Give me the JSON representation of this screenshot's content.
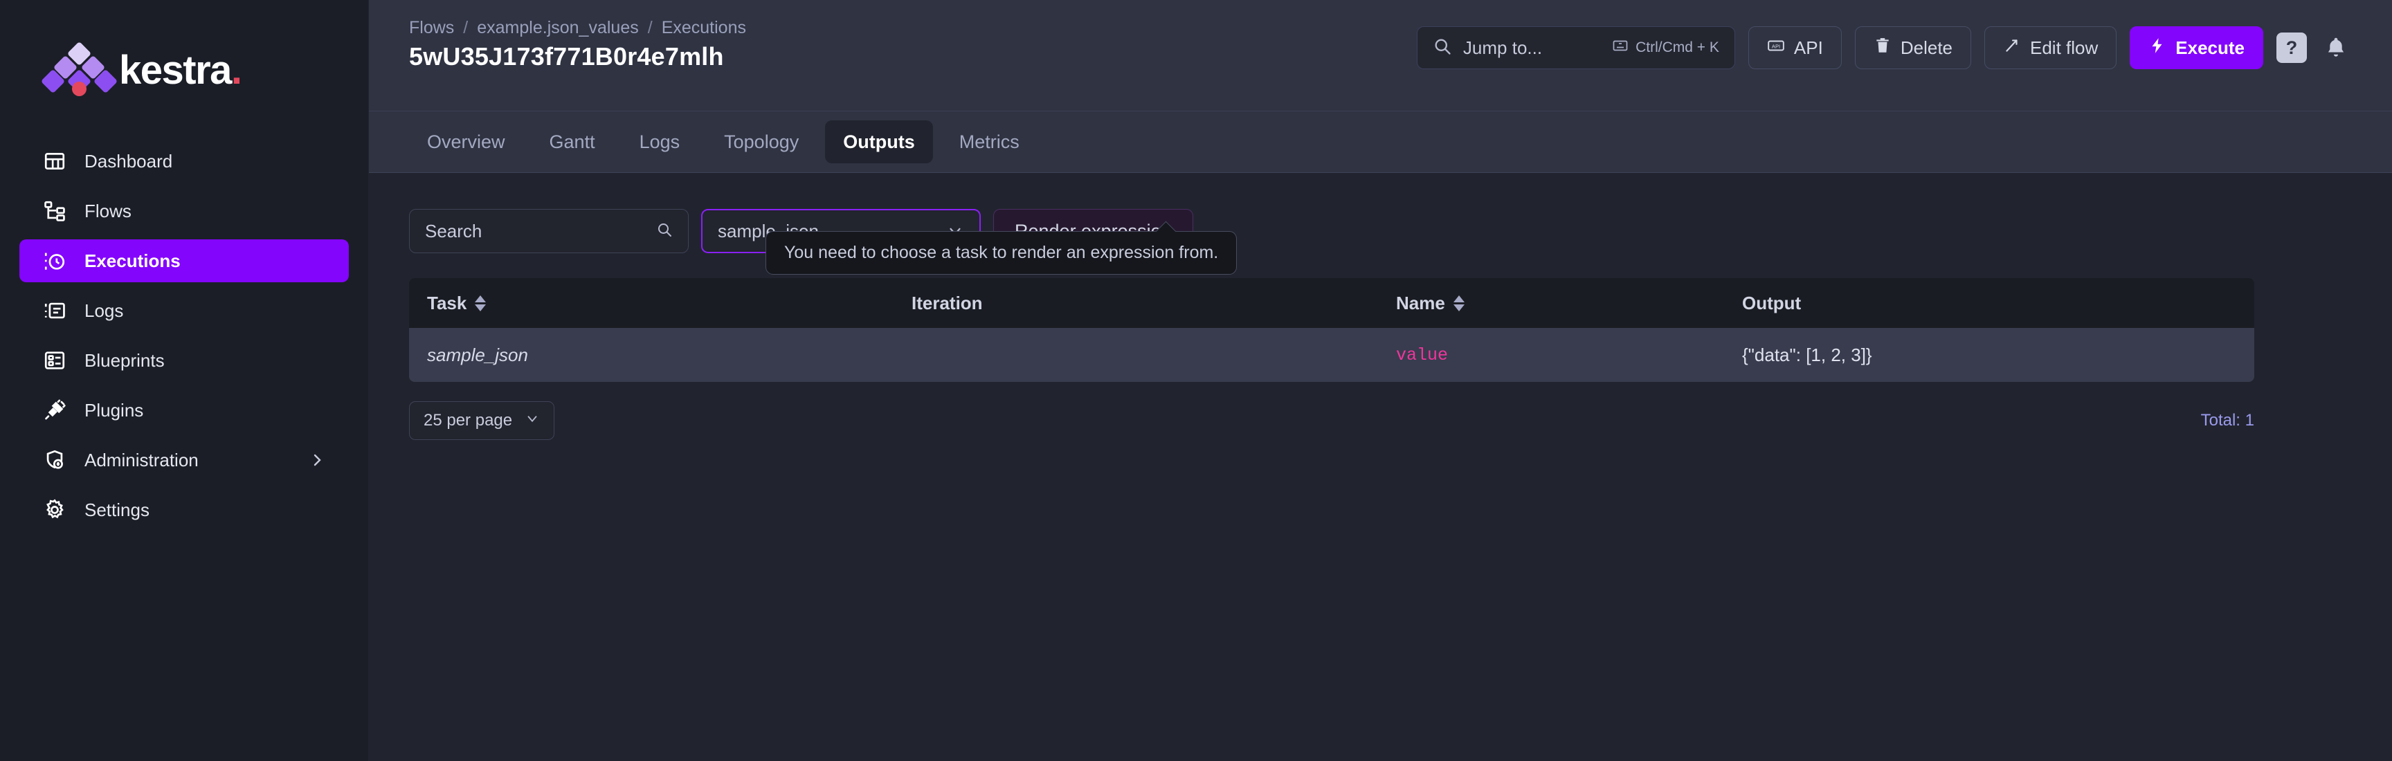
{
  "brand": {
    "name": "kestra",
    "accent": "#8405fc",
    "dot_color": "#e4485d"
  },
  "sidebar": {
    "items": [
      {
        "label": "Dashboard",
        "icon": "dashboard-icon",
        "active": false,
        "expandable": false
      },
      {
        "label": "Flows",
        "icon": "flows-icon",
        "active": false,
        "expandable": false
      },
      {
        "label": "Executions",
        "icon": "executions-icon",
        "active": true,
        "expandable": false
      },
      {
        "label": "Logs",
        "icon": "logs-icon",
        "active": false,
        "expandable": false
      },
      {
        "label": "Blueprints",
        "icon": "blueprints-icon",
        "active": false,
        "expandable": false
      },
      {
        "label": "Plugins",
        "icon": "plugins-icon",
        "active": false,
        "expandable": false
      },
      {
        "label": "Administration",
        "icon": "administration-icon",
        "active": false,
        "expandable": true
      },
      {
        "label": "Settings",
        "icon": "settings-icon",
        "active": false,
        "expandable": false
      }
    ]
  },
  "header": {
    "breadcrumb": [
      {
        "label": "Flows"
      },
      {
        "label": "example.json_values"
      },
      {
        "label": "Executions"
      }
    ],
    "breadcrumb_separator": "/",
    "title": "5wU35J173f771B0r4e7mlh",
    "jump_to": {
      "placeholder": "Jump to...",
      "shortcut": "Ctrl/Cmd + K",
      "icon": "search-icon",
      "keyboard_icon": "keyboard-icon"
    },
    "buttons": [
      {
        "label": "API",
        "icon": "api-icon",
        "style": "default"
      },
      {
        "label": "Delete",
        "icon": "trash-icon",
        "style": "default"
      },
      {
        "label": "Edit flow",
        "icon": "pencil-icon",
        "style": "default"
      },
      {
        "label": "Execute",
        "icon": "bolt-icon",
        "style": "primary"
      }
    ],
    "help_label": "?",
    "bell_icon": "bell-icon"
  },
  "tabs": [
    {
      "label": "Overview",
      "active": false
    },
    {
      "label": "Gantt",
      "active": false
    },
    {
      "label": "Logs",
      "active": false
    },
    {
      "label": "Topology",
      "active": false
    },
    {
      "label": "Outputs",
      "active": true
    },
    {
      "label": "Metrics",
      "active": false
    }
  ],
  "filters": {
    "search_placeholder": "Search",
    "search_value": "",
    "search_icon": "search-icon",
    "task_select_value": "sample_json",
    "task_select_icon": "chevron-down-icon",
    "render_button_label": "Render expression"
  },
  "tooltip": {
    "text": "You need to choose a task to render an expression from."
  },
  "table": {
    "columns": [
      {
        "label": "Task",
        "sortable": true
      },
      {
        "label": "Iteration",
        "sortable": false
      },
      {
        "label": "Name",
        "sortable": true
      },
      {
        "label": "Output",
        "sortable": false
      }
    ],
    "rows": [
      {
        "task": "sample_json",
        "iteration": "",
        "name": "value",
        "output": "{\"data\": [1, 2, 3]}"
      }
    ]
  },
  "pagination": {
    "per_page_label": "25 per page",
    "per_page_icon": "chevron-down-icon",
    "total_label": "Total: 1"
  }
}
